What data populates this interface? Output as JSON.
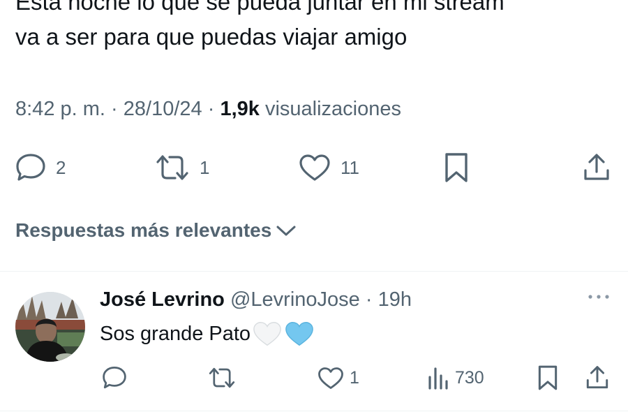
{
  "tweet": {
    "text_line1": "Esta noche lo que se pueda juntar en mi stream",
    "text_line2": "va a ser para que puedas viajar amigo",
    "time": "8:42 p. m.",
    "date": "28/10/24",
    "separator": "·",
    "views_count": "1,9k",
    "views_label": "visualizaciones",
    "replies": "2",
    "retweets": "1",
    "likes": "11"
  },
  "replies_section": {
    "title": "Respuestas más relevantes"
  },
  "reply": {
    "name": "José Levrino",
    "handle": "@LevrinoJose",
    "separator": "·",
    "time": "19h",
    "text": "Sos grande Pato",
    "emojis": [
      "white-heart",
      "light-blue-heart"
    ],
    "likes": "1",
    "views": "730"
  },
  "colors": {
    "text": "#0f1419",
    "secondary": "#536471",
    "divider": "#eff3f4",
    "light_blue_heart": "#74c7ef"
  }
}
